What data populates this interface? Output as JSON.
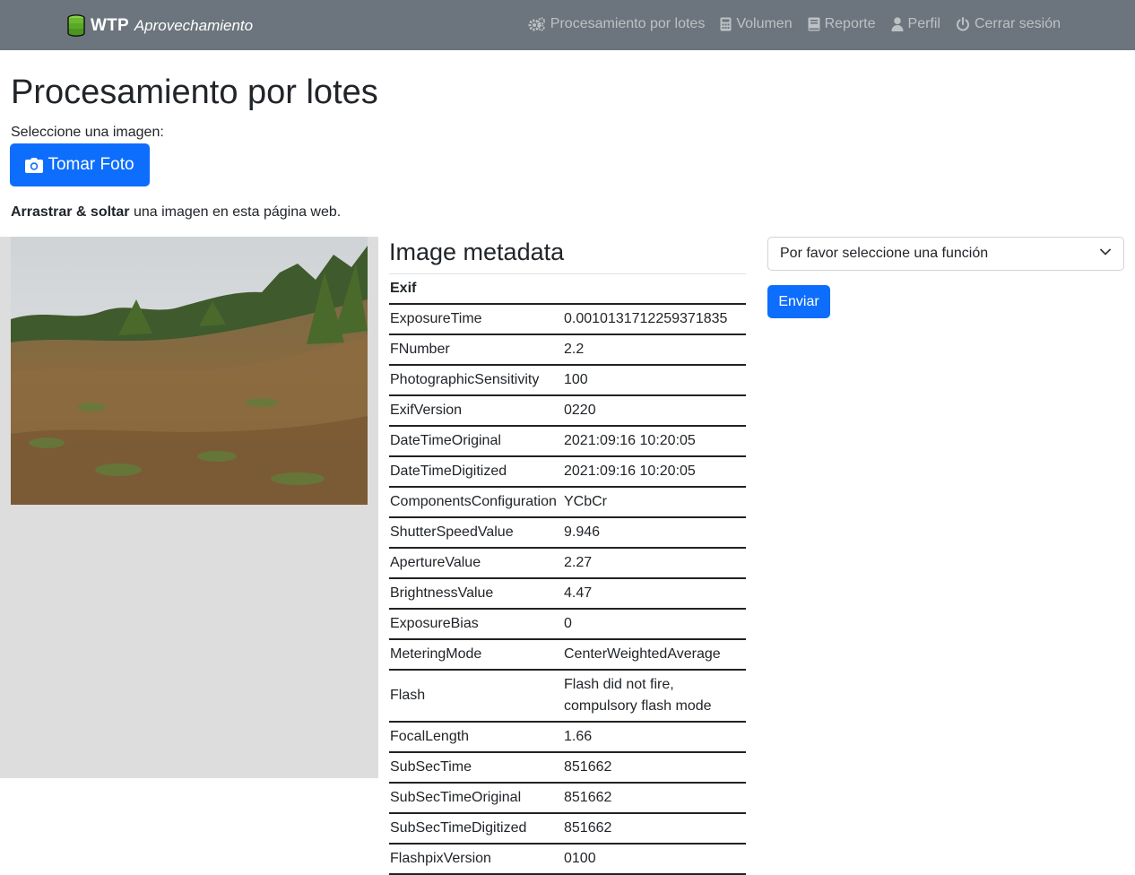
{
  "navbar": {
    "brand_strong": "WTP",
    "brand_em": "Aprovechamiento",
    "items": [
      {
        "label": "Procesamiento por lotes",
        "icon": "gears-icon"
      },
      {
        "label": "Volumen",
        "icon": "calculator-icon"
      },
      {
        "label": "Reporte",
        "icon": "book-icon"
      },
      {
        "label": "Perfil",
        "icon": "user-icon"
      },
      {
        "label": "Cerrar sesión",
        "icon": "power-icon"
      }
    ]
  },
  "page": {
    "title": "Procesamiento por lotes",
    "select_label": "Seleccione una imagen:",
    "photo_button": "Tomar Foto",
    "drag_strong": "Arrastrar & soltar",
    "drag_rest": " una imagen en esta página web."
  },
  "metadata": {
    "title": "Image metadata",
    "group": "Exif",
    "rows": [
      {
        "key": "ExposureTime",
        "value": "0.0010131712259371835"
      },
      {
        "key": "FNumber",
        "value": "2.2"
      },
      {
        "key": "PhotographicSensitivity",
        "value": "100"
      },
      {
        "key": "ExifVersion",
        "value": "0220"
      },
      {
        "key": "DateTimeOriginal",
        "value": "2021:09:16 10:20:05"
      },
      {
        "key": "DateTimeDigitized",
        "value": "2021:09:16 10:20:05"
      },
      {
        "key": "ComponentsConfiguration",
        "value": "YCbCr"
      },
      {
        "key": "ShutterSpeedValue",
        "value": "9.946"
      },
      {
        "key": "ApertureValue",
        "value": "2.27"
      },
      {
        "key": "BrightnessValue",
        "value": "4.47"
      },
      {
        "key": "ExposureBias",
        "value": "0"
      },
      {
        "key": "MeteringMode",
        "value": "CenterWeightedAverage"
      },
      {
        "key": "Flash",
        "value": "Flash did not fire, compulsory flash mode"
      },
      {
        "key": "FocalLength",
        "value": "1.66"
      },
      {
        "key": "SubSecTime",
        "value": "851662"
      },
      {
        "key": "SubSecTimeOriginal",
        "value": "851662"
      },
      {
        "key": "SubSecTimeDigitized",
        "value": "851662"
      },
      {
        "key": "FlashpixVersion",
        "value": "0100"
      }
    ]
  },
  "form": {
    "select_value": "Por favor seleccione una función",
    "submit_label": "Enviar"
  },
  "colors": {
    "navbar": "#6c757d",
    "primary": "#0d6efd",
    "panel": "#dddddd"
  }
}
